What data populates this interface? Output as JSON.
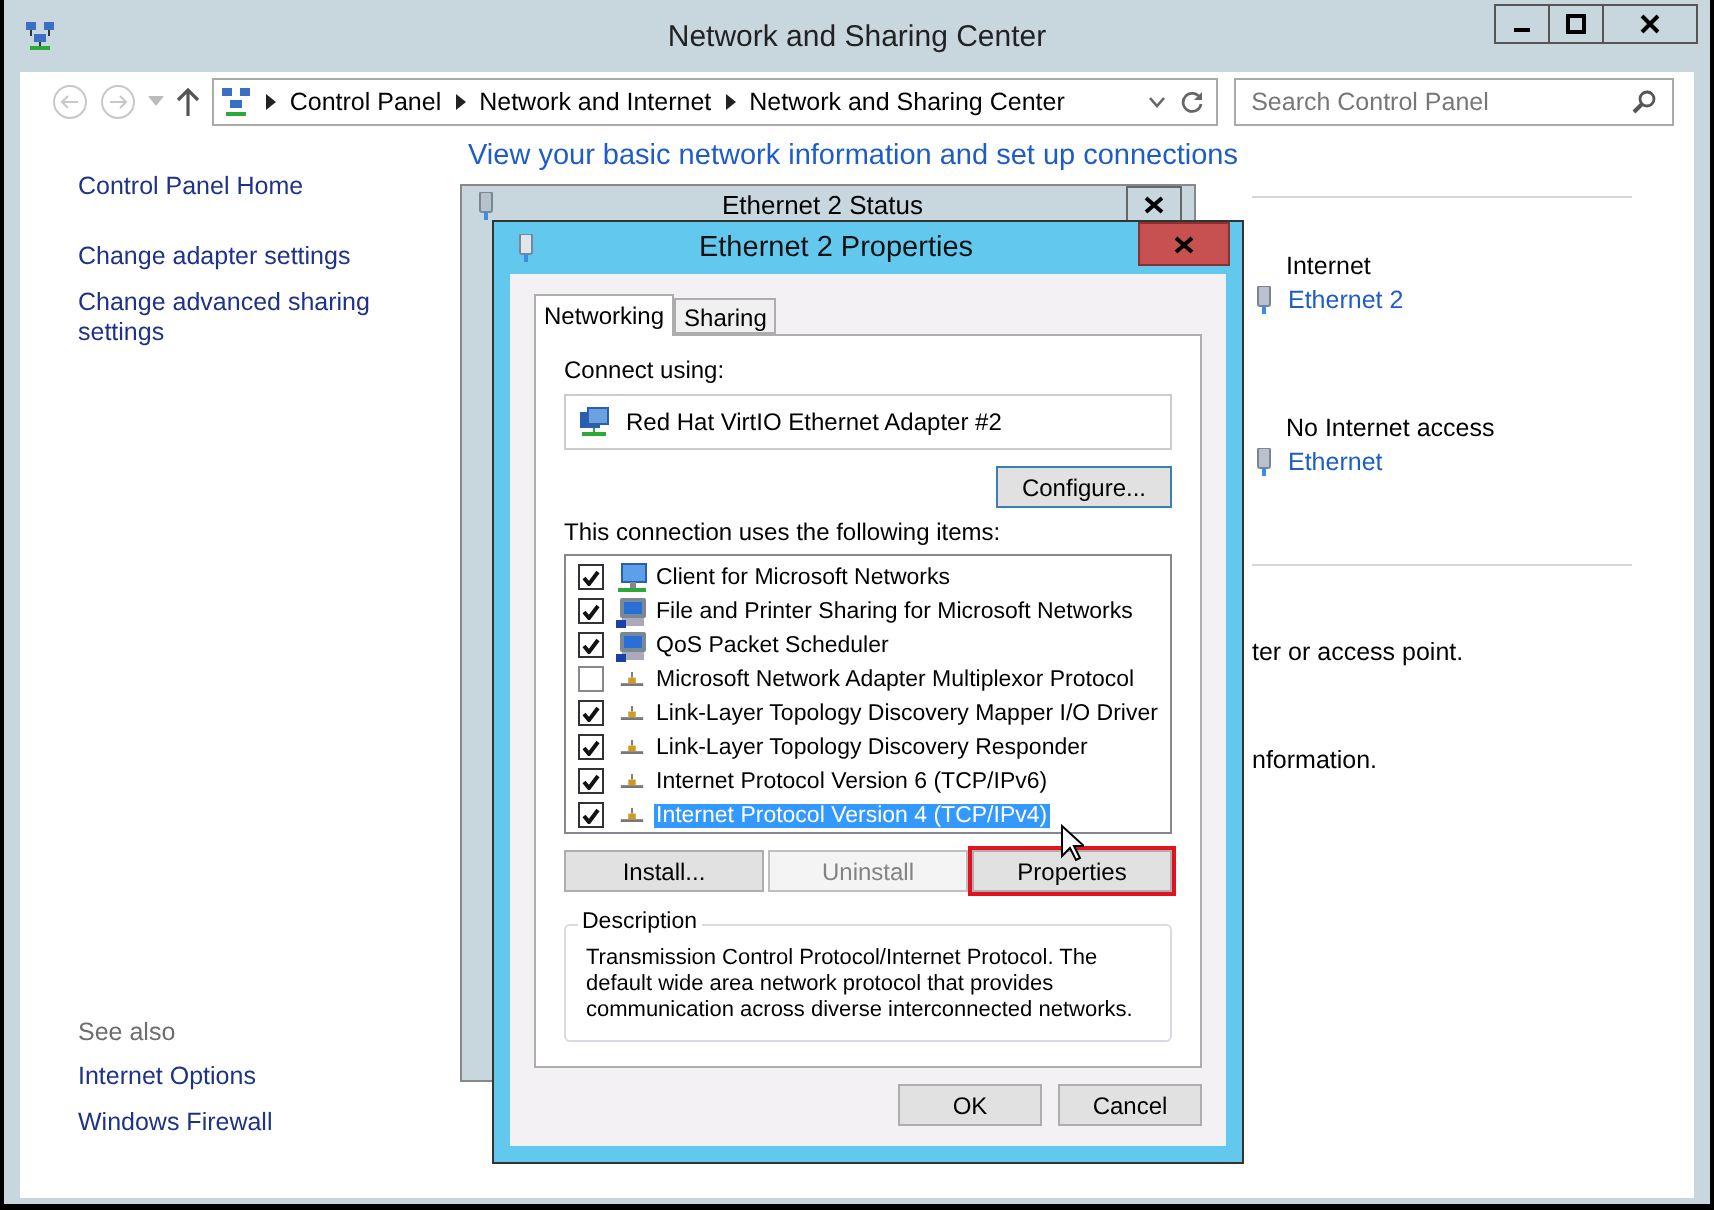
{
  "window": {
    "title": "Network and Sharing Center"
  },
  "address_bar": {
    "breadcrumbs": [
      "Control Panel",
      "Network and Internet",
      "Network and Sharing Center"
    ]
  },
  "search": {
    "placeholder": "Search Control Panel"
  },
  "sidebar": {
    "items": [
      "Control Panel Home",
      "Change adapter settings",
      "Change advanced sharing settings"
    ],
    "see_also_heading": "See also",
    "see_also": [
      "Internet Options",
      "Windows Firewall"
    ]
  },
  "main": {
    "heading": "View your basic network information and set up connections",
    "connections": [
      {
        "type_label": "Internet",
        "link": "Ethernet 2"
      },
      {
        "type_label": "No Internet access",
        "link": "Ethernet"
      }
    ],
    "fragments": [
      "ter or access point.",
      "nformation."
    ]
  },
  "status_dialog": {
    "title": "Ethernet 2 Status"
  },
  "properties_dialog": {
    "title": "Ethernet 2 Properties",
    "tabs": [
      {
        "label": "Networking",
        "selected": true
      },
      {
        "label": "Sharing",
        "selected": false
      }
    ],
    "connect_using_label": "Connect using:",
    "adapter": "Red Hat VirtIO Ethernet Adapter #2",
    "configure_button": "Configure...",
    "items_label": "This connection uses the following items:",
    "items": [
      {
        "label": "Client for Microsoft Networks",
        "checked": true,
        "selected": false,
        "kind": "client"
      },
      {
        "label": "File and Printer Sharing for Microsoft Networks",
        "checked": true,
        "selected": false,
        "kind": "service"
      },
      {
        "label": "QoS Packet Scheduler",
        "checked": true,
        "selected": false,
        "kind": "service"
      },
      {
        "label": "Microsoft Network Adapter Multiplexor Protocol",
        "checked": false,
        "selected": false,
        "kind": "protocol"
      },
      {
        "label": "Link-Layer Topology Discovery Mapper I/O Driver",
        "checked": true,
        "selected": false,
        "kind": "protocol"
      },
      {
        "label": "Link-Layer Topology Discovery Responder",
        "checked": true,
        "selected": false,
        "kind": "protocol"
      },
      {
        "label": "Internet Protocol Version 6 (TCP/IPv6)",
        "checked": true,
        "selected": false,
        "kind": "protocol"
      },
      {
        "label": "Internet Protocol Version 4 (TCP/IPv4)",
        "checked": true,
        "selected": true,
        "kind": "protocol"
      }
    ],
    "buttons": [
      {
        "label": "Install...",
        "disabled": false,
        "highlighted": false
      },
      {
        "label": "Uninstall",
        "disabled": true,
        "highlighted": false
      },
      {
        "label": "Properties",
        "disabled": false,
        "highlighted": true
      }
    ],
    "description_title": "Description",
    "description": "Transmission Control Protocol/Internet Protocol. The default wide area network protocol that provides communication across diverse interconnected networks.",
    "footer_buttons": [
      "OK",
      "Cancel"
    ]
  }
}
